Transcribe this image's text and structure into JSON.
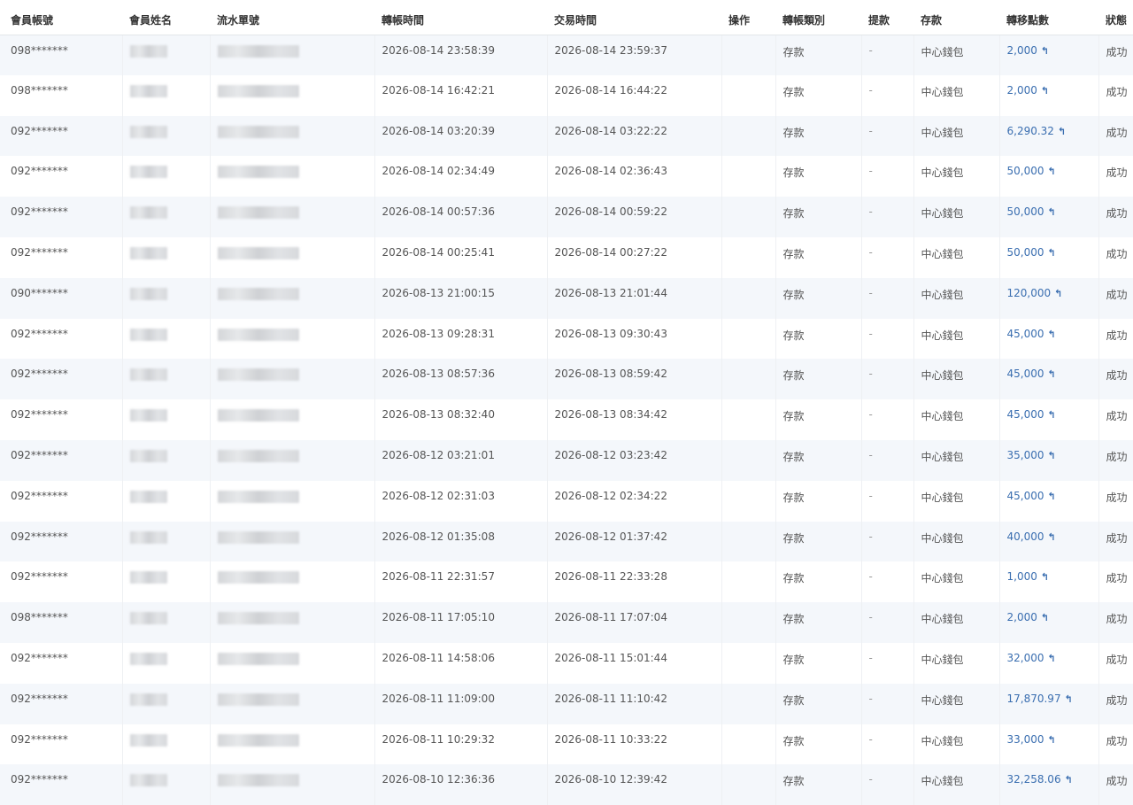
{
  "columns": [
    "會員帳號",
    "會員姓名",
    "流水單號",
    "轉帳時間",
    "交易時間",
    "操作",
    "轉帳類別",
    "提款",
    "存款",
    "轉移點數",
    "狀態"
  ],
  "rows": [
    {
      "account": "098*******",
      "transfer_time": "2026-08-14 23:58:39",
      "trade_time": "2026-08-14 23:59:37",
      "category": "存款",
      "withdraw": "-",
      "deposit": "中心錢包",
      "amount": "2,000",
      "status": "成功"
    },
    {
      "account": "098*******",
      "transfer_time": "2026-08-14 16:42:21",
      "trade_time": "2026-08-14 16:44:22",
      "category": "存款",
      "withdraw": "-",
      "deposit": "中心錢包",
      "amount": "2,000",
      "status": "成功"
    },
    {
      "account": "092*******",
      "transfer_time": "2026-08-14 03:20:39",
      "trade_time": "2026-08-14 03:22:22",
      "category": "存款",
      "withdraw": "-",
      "deposit": "中心錢包",
      "amount": "6,290.32",
      "status": "成功"
    },
    {
      "account": "092*******",
      "transfer_time": "2026-08-14 02:34:49",
      "trade_time": "2026-08-14 02:36:43",
      "category": "存款",
      "withdraw": "-",
      "deposit": "中心錢包",
      "amount": "50,000",
      "status": "成功"
    },
    {
      "account": "092*******",
      "transfer_time": "2026-08-14 00:57:36",
      "trade_time": "2026-08-14 00:59:22",
      "category": "存款",
      "withdraw": "-",
      "deposit": "中心錢包",
      "amount": "50,000",
      "status": "成功"
    },
    {
      "account": "092*******",
      "transfer_time": "2026-08-14 00:25:41",
      "trade_time": "2026-08-14 00:27:22",
      "category": "存款",
      "withdraw": "-",
      "deposit": "中心錢包",
      "amount": "50,000",
      "status": "成功"
    },
    {
      "account": "090*******",
      "transfer_time": "2026-08-13 21:00:15",
      "trade_time": "2026-08-13 21:01:44",
      "category": "存款",
      "withdraw": "-",
      "deposit": "中心錢包",
      "amount": "120,000",
      "status": "成功"
    },
    {
      "account": "092*******",
      "transfer_time": "2026-08-13 09:28:31",
      "trade_time": "2026-08-13 09:30:43",
      "category": "存款",
      "withdraw": "-",
      "deposit": "中心錢包",
      "amount": "45,000",
      "status": "成功"
    },
    {
      "account": "092*******",
      "transfer_time": "2026-08-13 08:57:36",
      "trade_time": "2026-08-13 08:59:42",
      "category": "存款",
      "withdraw": "-",
      "deposit": "中心錢包",
      "amount": "45,000",
      "status": "成功"
    },
    {
      "account": "092*******",
      "transfer_time": "2026-08-13 08:32:40",
      "trade_time": "2026-08-13 08:34:42",
      "category": "存款",
      "withdraw": "-",
      "deposit": "中心錢包",
      "amount": "45,000",
      "status": "成功"
    },
    {
      "account": "092*******",
      "transfer_time": "2026-08-12 03:21:01",
      "trade_time": "2026-08-12 03:23:42",
      "category": "存款",
      "withdraw": "-",
      "deposit": "中心錢包",
      "amount": "35,000",
      "status": "成功"
    },
    {
      "account": "092*******",
      "transfer_time": "2026-08-12 02:31:03",
      "trade_time": "2026-08-12 02:34:22",
      "category": "存款",
      "withdraw": "-",
      "deposit": "中心錢包",
      "amount": "45,000",
      "status": "成功"
    },
    {
      "account": "092*******",
      "transfer_time": "2026-08-12 01:35:08",
      "trade_time": "2026-08-12 01:37:42",
      "category": "存款",
      "withdraw": "-",
      "deposit": "中心錢包",
      "amount": "40,000",
      "status": "成功"
    },
    {
      "account": "092*******",
      "transfer_time": "2026-08-11 22:31:57",
      "trade_time": "2026-08-11 22:33:28",
      "category": "存款",
      "withdraw": "-",
      "deposit": "中心錢包",
      "amount": "1,000",
      "status": "成功"
    },
    {
      "account": "098*******",
      "transfer_time": "2026-08-11 17:05:10",
      "trade_time": "2026-08-11 17:07:04",
      "category": "存款",
      "withdraw": "-",
      "deposit": "中心錢包",
      "amount": "2,000",
      "status": "成功"
    },
    {
      "account": "092*******",
      "transfer_time": "2026-08-11 14:58:06",
      "trade_time": "2026-08-11 15:01:44",
      "category": "存款",
      "withdraw": "-",
      "deposit": "中心錢包",
      "amount": "32,000",
      "status": "成功"
    },
    {
      "account": "092*******",
      "transfer_time": "2026-08-11 11:09:00",
      "trade_time": "2026-08-11 11:10:42",
      "category": "存款",
      "withdraw": "-",
      "deposit": "中心錢包",
      "amount": "17,870.97",
      "status": "成功"
    },
    {
      "account": "092*******",
      "transfer_time": "2026-08-11 10:29:32",
      "trade_time": "2026-08-11 10:33:22",
      "category": "存款",
      "withdraw": "-",
      "deposit": "中心錢包",
      "amount": "33,000",
      "status": "成功"
    },
    {
      "account": "092*******",
      "transfer_time": "2026-08-10 12:36:36",
      "trade_time": "2026-08-10 12:39:42",
      "category": "存款",
      "withdraw": "-",
      "deposit": "中心錢包",
      "amount": "32,258.06",
      "status": "成功"
    }
  ],
  "icons": {
    "amount_action": "undo-arrow-icon"
  },
  "colors": {
    "link": "#3a6eb0",
    "row_stripe": "#f4f7fb"
  }
}
